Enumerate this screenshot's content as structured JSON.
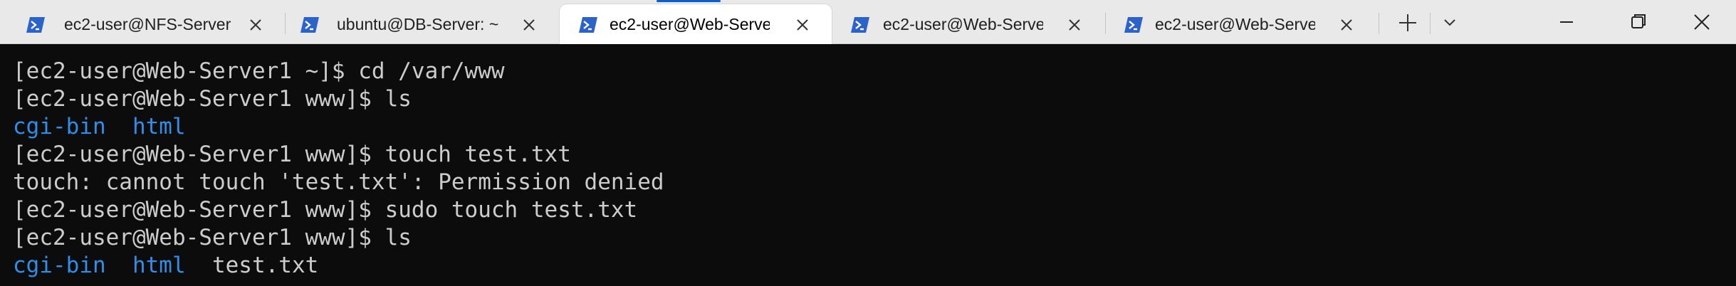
{
  "tabs": [
    {
      "label": "ec2-user@NFS-Server",
      "icon": "powershell-icon",
      "active": false
    },
    {
      "label": "ubuntu@DB-Server: ~",
      "icon": "powershell-icon",
      "active": false
    },
    {
      "label": "ec2-user@Web-Serve",
      "icon": "powershell-icon",
      "active": true
    },
    {
      "label": "ec2-user@Web-Serve",
      "icon": "powershell-icon",
      "active": false
    },
    {
      "label": "ec2-user@Web-Serve",
      "icon": "powershell-icon",
      "active": false
    }
  ],
  "toolbar": {
    "new_tab_icon": "plus-icon",
    "dropdown_icon": "chevron-down-icon"
  },
  "window_controls": {
    "minimize_icon": "minimize-icon",
    "restore_icon": "restore-icon",
    "close_icon": "close-icon"
  },
  "terminal": {
    "lines": [
      {
        "text": "[ec2-user@Web-Server1 ~]$ cd /var/www"
      },
      {
        "text": "[ec2-user@Web-Server1 www]$ ls"
      },
      {
        "dir1": "cgi-bin",
        "dir2": "html"
      },
      {
        "text": "[ec2-user@Web-Server1 www]$ touch test.txt"
      },
      {
        "text": "touch: cannot touch 'test.txt': Permission denied"
      },
      {
        "text": "[ec2-user@Web-Server1 www]$ sudo touch test.txt"
      },
      {
        "text": "[ec2-user@Web-Server1 www]$ ls"
      },
      {
        "dir1": "cgi-bin",
        "dir2": "html",
        "file1": "test.txt"
      }
    ]
  },
  "colors": {
    "terminal_bg": "#0c0c0c",
    "terminal_fg": "#cccccc",
    "directory": "#2f8ee8",
    "accent": "#0a5fd0"
  }
}
